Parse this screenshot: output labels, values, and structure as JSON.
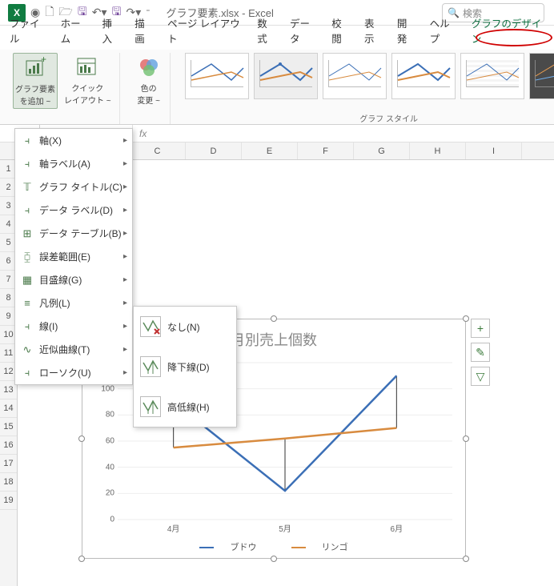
{
  "title": "グラフ要素.xlsx - Excel",
  "search_placeholder": "検索",
  "tabs": [
    "ファイル",
    "ホーム",
    "挿入",
    "描画",
    "ページ レイアウト",
    "数式",
    "データ",
    "校閲",
    "表示",
    "開発",
    "ヘルプ",
    "グラフのデザイン"
  ],
  "ribbon": {
    "add_element": "グラフ要素\nを追加 ~",
    "quick_layout": "クイック\nレイアウト ~",
    "change_colors": "色の\n変更 ~",
    "styles_label": "グラフ スタイル"
  },
  "menu_items": [
    {
      "label": "軸(X)",
      "icon": "⫞"
    },
    {
      "label": "軸ラベル(A)",
      "icon": "⫞"
    },
    {
      "label": "グラフ タイトル(C)",
      "icon": "𝕋"
    },
    {
      "label": "データ ラベル(D)",
      "icon": "⫞"
    },
    {
      "label": "データ テーブル(B)",
      "icon": "⊞"
    },
    {
      "label": "誤差範囲(E)",
      "icon": "⧮"
    },
    {
      "label": "目盛線(G)",
      "icon": "▦"
    },
    {
      "label": "凡例(L)",
      "icon": "≡"
    },
    {
      "label": "線(I)",
      "icon": "⫞"
    },
    {
      "label": "近似曲線(T)",
      "icon": "∿"
    },
    {
      "label": "ローソク(U)",
      "icon": "⫞"
    }
  ],
  "submenu_items": [
    {
      "label": "なし(N)",
      "icon": "✕"
    },
    {
      "label": "降下線(D)",
      "icon": "│"
    },
    {
      "label": "高低線(H)",
      "icon": "│"
    }
  ],
  "columns": [
    "",
    "C",
    "D",
    "E",
    "F",
    "G",
    "H",
    "I"
  ],
  "rows": [
    "1",
    "2",
    "3",
    "4",
    "5",
    "6",
    "7",
    "8",
    "9",
    "10",
    "11",
    "12",
    "13",
    "14",
    "15",
    "16",
    "17",
    "18",
    "19"
  ],
  "chart_data": {
    "type": "line",
    "title": "月別売上個数",
    "categories": [
      "4月",
      "5月",
      "6月"
    ],
    "series": [
      {
        "name": "ブドウ",
        "color": "#3b6fb6",
        "values": [
          90,
          22,
          110
        ]
      },
      {
        "name": "リンゴ",
        "color": "#d88b3f",
        "values": [
          55,
          62,
          70
        ]
      }
    ],
    "ylim": [
      0,
      120
    ],
    "yticks": [
      0,
      20,
      40,
      60,
      80,
      100,
      120
    ]
  },
  "side_buttons": [
    "+",
    "✎",
    "▽"
  ]
}
